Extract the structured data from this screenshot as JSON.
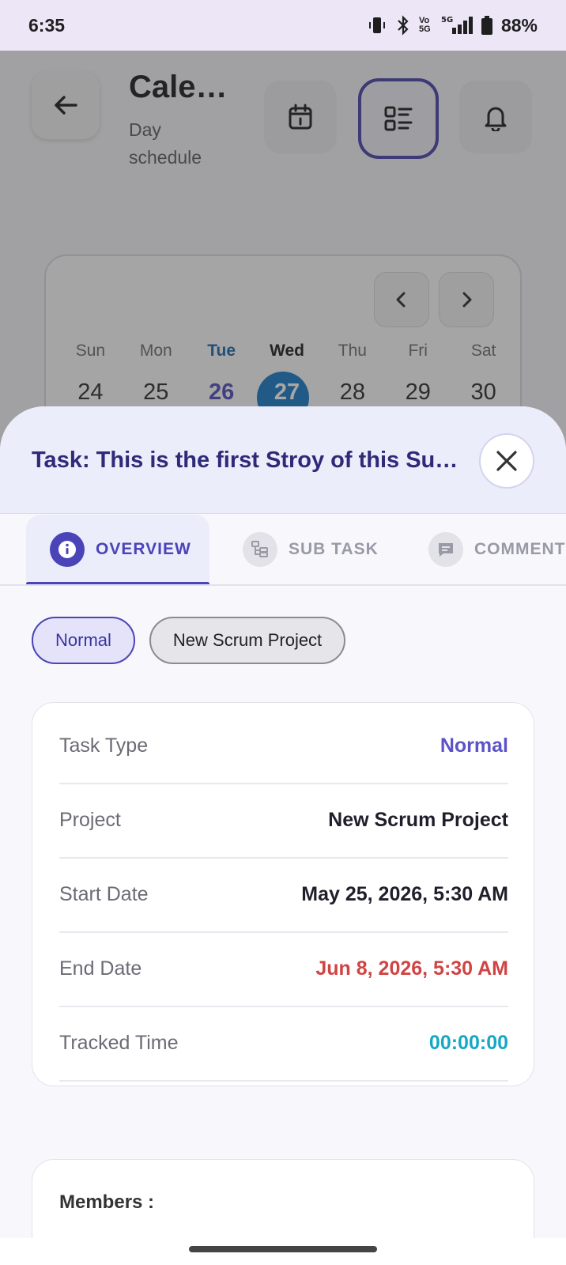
{
  "status_bar": {
    "time": "6:35",
    "battery": "88%",
    "network": "5G",
    "volte": "Vo 5G"
  },
  "header": {
    "title": "Cale…",
    "subtitle": "Day schedule"
  },
  "calendar": {
    "weekdays": [
      "Sun",
      "Mon",
      "Tue",
      "Wed",
      "Thu",
      "Fri",
      "Sat"
    ],
    "dates": [
      "24",
      "25",
      "26",
      "27",
      "28",
      "29",
      "30"
    ]
  },
  "sheet": {
    "title": "Task: This is the first Stroy of this Su…",
    "tabs": [
      {
        "label": "OVERVIEW"
      },
      {
        "label": "SUB TASK"
      },
      {
        "label": "COMMENTS"
      }
    ],
    "chips": [
      "Normal",
      "New Scrum Project"
    ],
    "details": [
      {
        "label": "Task Type",
        "value": "Normal",
        "color": "#5b53c9"
      },
      {
        "label": "Project",
        "value": "New Scrum Project",
        "color": "#1f1f2b"
      },
      {
        "label": "Start Date",
        "value": "May 25, 2026, 5:30 AM",
        "color": "#1f1f2b"
      },
      {
        "label": "End Date",
        "value": "Jun 8, 2026, 5:30 AM",
        "color": "#d04444"
      },
      {
        "label": "Tracked Time",
        "value": "00:00:00",
        "color": "#15a8c4"
      }
    ],
    "members_label": "Members :"
  },
  "colors": {
    "accent": "#4a44b8",
    "today": "#0b74c4"
  }
}
